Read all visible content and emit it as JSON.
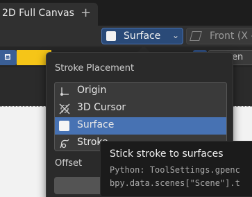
{
  "tab": {
    "label": "2D Full Canvas",
    "add": "+"
  },
  "header": {
    "placement_dropdown": {
      "label": "Surface",
      "chevron": "⌄"
    },
    "view_dropdown": {
      "label": "Front (X –"
    }
  },
  "toolbar": {
    "right_field": "Extren"
  },
  "popup": {
    "title": "Stroke Placement",
    "items": [
      {
        "label": "Origin",
        "icon": "origin-icon",
        "selected": false
      },
      {
        "label": "3D Cursor",
        "icon": "cursor-3d-icon",
        "selected": false
      },
      {
        "label": "Surface",
        "icon": "surface-icon",
        "selected": true
      },
      {
        "label": "Stroke",
        "icon": "stroke-icon",
        "selected": false
      }
    ],
    "offset_label": "Offset"
  },
  "tooltip": {
    "title": "Stick stroke to surfaces",
    "python": "Python: ToolSettings.gpenc",
    "path": "bpy.data.scenes[\"Scene\"].t"
  },
  "colors": {
    "accent": "#4772b3",
    "yellow": "#f5c518",
    "canvas": "#f2f2f2"
  }
}
